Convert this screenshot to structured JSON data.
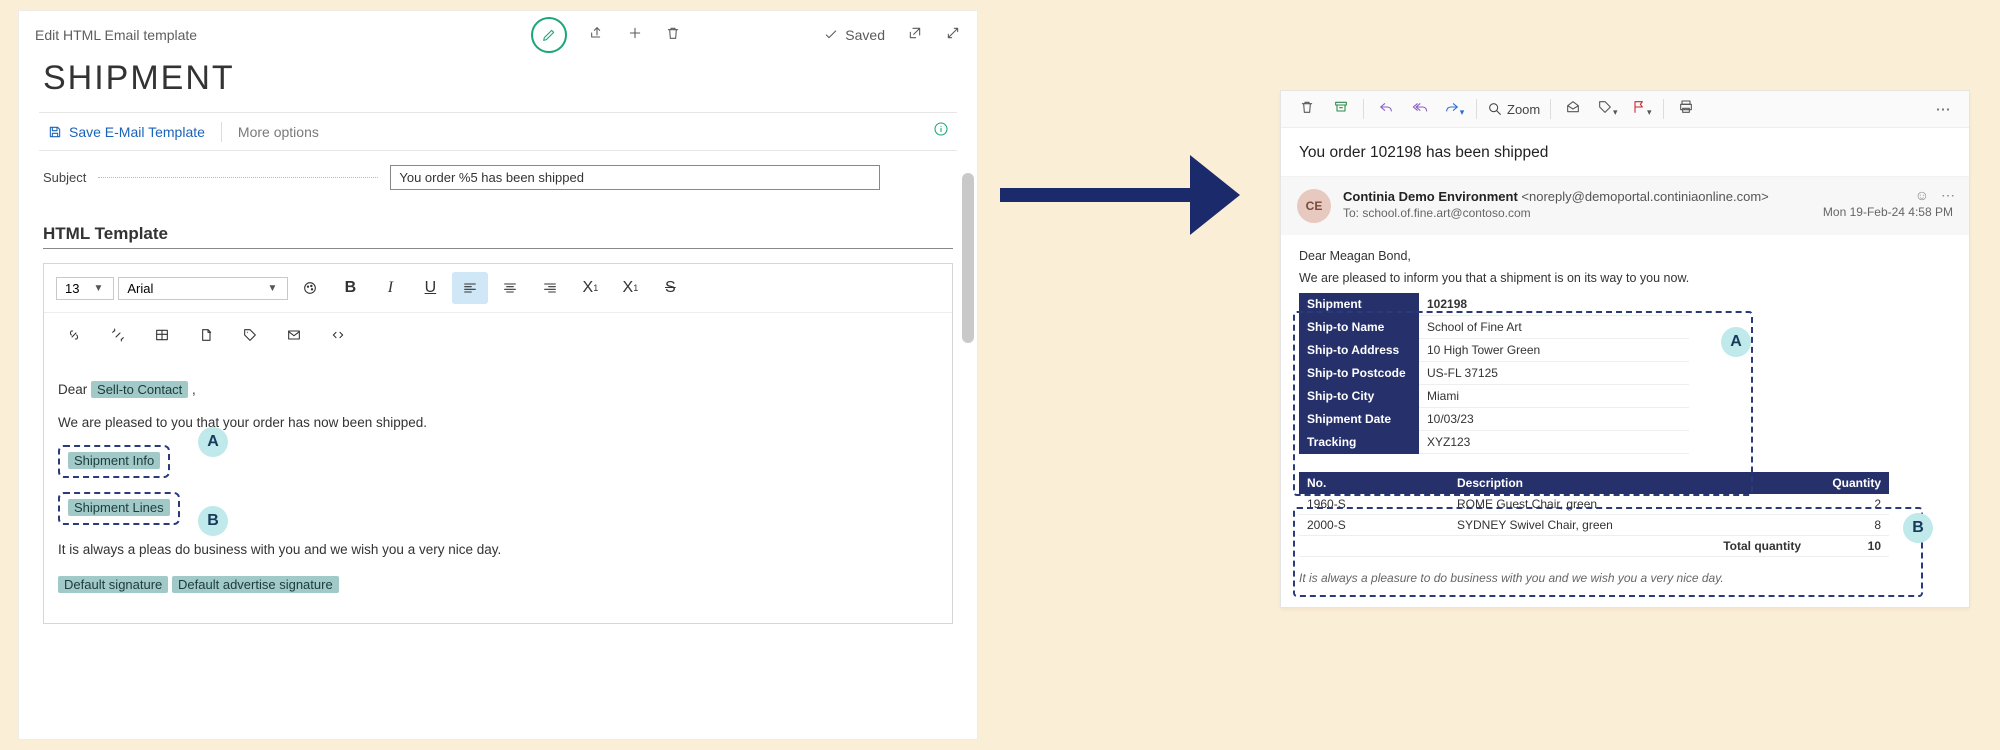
{
  "editor": {
    "breadcrumb": "Edit HTML Email template",
    "saved_label": "Saved",
    "page_title": "SHIPMENT",
    "save_template_btn": "Save E-Mail Template",
    "more_options": "More options",
    "subject_label": "Subject",
    "subject_value": "You order %5 has been shipped",
    "section_heading": "HTML Template",
    "font_size": "13",
    "font_name": "Arial",
    "body": {
      "greeting_prefix": "Dear",
      "greeting_chip": "Sell-to Contact",
      "greeting_suffix": " ,",
      "intro_prefix": "We are pleased to ",
      "intro_suffix": " you that your order has now been shipped.",
      "chipA": "Shipment Info",
      "chipB": "Shipment Lines",
      "closing_prefix": "It is always a pleas",
      "closing_suffix": " do business with you and we wish you a very nice day.",
      "sig1": "Default signature",
      "sig2": "Default advertise signature"
    },
    "calloutA": "A",
    "calloutB": "B"
  },
  "mail": {
    "zoom_label": "Zoom",
    "subject": "You order 102198 has been shipped",
    "avatar_initials": "CE",
    "from_name": "Continia Demo Environment",
    "from_addr": "<noreply@demoportal.continiaonline.com>",
    "to_label": "To:",
    "to_value": "school.of.fine.art@contoso.com",
    "date": "Mon 19-Feb-24 4:58 PM",
    "greeting": "Dear Meagan Bond,",
    "intro": "We are pleased to inform you that a shipment is on its way to you now.",
    "ship_rows": [
      {
        "k": "Shipment",
        "v": "102198",
        "bold": true
      },
      {
        "k": "Ship-to Name",
        "v": "School of Fine Art"
      },
      {
        "k": "Ship-to Address",
        "v": "10 High Tower Green"
      },
      {
        "k": "Ship-to Postcode",
        "v": "US-FL 37125"
      },
      {
        "k": "Ship-to City",
        "v": "Miami"
      },
      {
        "k": "Shipment Date",
        "v": "10/03/23"
      },
      {
        "k": "Tracking",
        "v": "XYZ123"
      }
    ],
    "items_head": {
      "no": "No.",
      "desc": "Description",
      "qty": "Quantity"
    },
    "items": [
      {
        "no": "1960-S",
        "desc": "ROME Guest Chair, green",
        "qty": "2"
      },
      {
        "no": "2000-S",
        "desc": "SYDNEY Swivel Chair, green",
        "qty": "8"
      }
    ],
    "total_label": "Total quantity",
    "total_value": "10",
    "closing": "It is always a pleasure to do business with you and we wish you a very nice day.",
    "calloutA": "A",
    "calloutB": "B"
  }
}
